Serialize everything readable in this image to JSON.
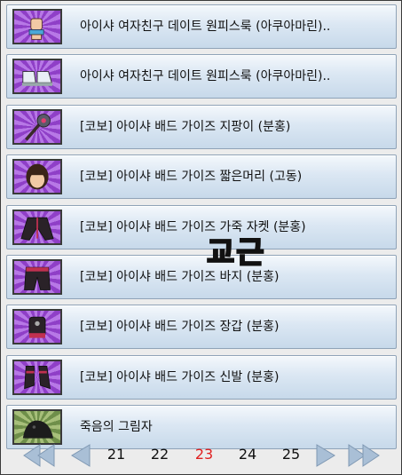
{
  "items": [
    {
      "label": "아이샤 여자친구 데이트 원피스룩 (아쿠아마린)..",
      "icon": "hand-icon"
    },
    {
      "label": "아이샤 여자친구 데이트 원피스룩 (아쿠아마린)..",
      "icon": "shoes-icon"
    },
    {
      "label": "[코보] 아이샤 배드 가이즈 지팡이 (분홍)",
      "icon": "staff-icon"
    },
    {
      "label": "[코보] 아이샤 배드 가이즈 짧은머리 (고동)",
      "icon": "hair-icon"
    },
    {
      "label": "[코보] 아이샤 배드 가이즈 가죽 자켓 (분홍)",
      "icon": "jacket-icon"
    },
    {
      "label": "[코보] 아이샤 배드 가이즈 바지 (분홍)",
      "icon": "pants-icon"
    },
    {
      "label": "[코보] 아이샤 배드 가이즈 장갑 (분홍)",
      "icon": "gloves-icon"
    },
    {
      "label": "[코보] 아이샤 배드 가이즈 신발 (분홍)",
      "icon": "boots-icon"
    },
    {
      "label": "죽음의 그림자",
      "icon": "shadow-icon"
    }
  ],
  "pager": {
    "pages": [
      "21",
      "22",
      "23",
      "24",
      "25"
    ],
    "current": "23"
  },
  "watermark": "교근"
}
